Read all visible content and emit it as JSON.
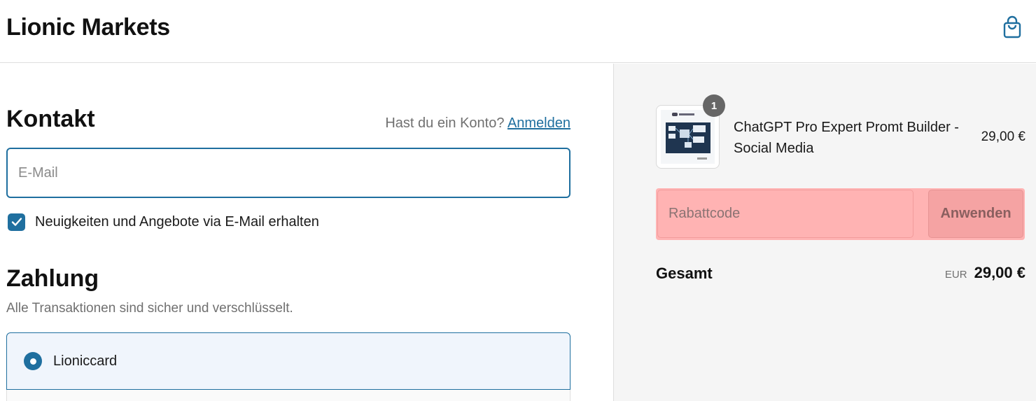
{
  "header": {
    "brand": "Lionic Markets",
    "cart_icon": "shopping-bag-icon"
  },
  "contact": {
    "title": "Kontakt",
    "login_prompt": "Hast du ein Konto?",
    "login_link": "Anmelden",
    "email_placeholder": "E-Mail",
    "email_value": "",
    "newsletter_label": "Neuigkeiten und Angebote via E-Mail erhalten",
    "newsletter_checked": true
  },
  "payment": {
    "title": "Zahlung",
    "subtitle": "Alle Transaktionen sind sicher und verschlüsselt.",
    "options": [
      {
        "label": "Lioniccard",
        "selected": true
      }
    ]
  },
  "summary": {
    "items": [
      {
        "name": "ChatGPT Pro Expert Promt Builder - Social Media",
        "price": "29,00 €",
        "quantity": "1"
      }
    ],
    "discount_placeholder": "Rabattcode",
    "apply_label": "Anwenden",
    "total_label": "Gesamt",
    "currency": "EUR",
    "total_value": "29,00 €"
  },
  "colors": {
    "accent": "#1f6f9f",
    "summary_bg": "#f5f5f5",
    "discount_highlight": "#ffb3b3"
  }
}
